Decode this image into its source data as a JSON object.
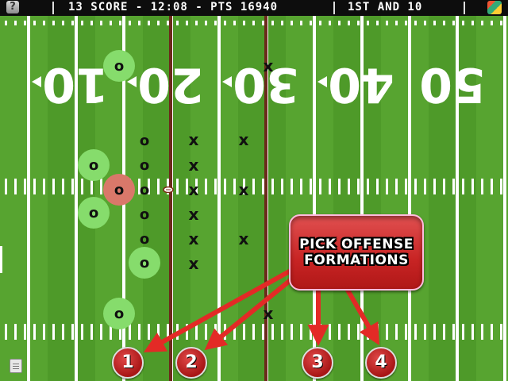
{
  "topbar": {
    "help_label": "?",
    "score_text": "13 SCORE - 12:08 - PTS 16940",
    "down_text": "1ST AND 10"
  },
  "field": {
    "yard_numbers": [
      "10",
      "20",
      "30",
      "40",
      "50"
    ],
    "field_color": "#57a430",
    "line_of_scrimmage_color": "#6b2a1a"
  },
  "players": {
    "offense_marker": "o",
    "defense_marker": "x"
  },
  "callout": {
    "line1": "PICK OFFENSE",
    "line2": "FORMATIONS"
  },
  "formation_buttons": [
    {
      "label": "1"
    },
    {
      "label": "2"
    },
    {
      "label": "3"
    },
    {
      "label": "4"
    }
  ],
  "accent_color": "#d42a2a"
}
